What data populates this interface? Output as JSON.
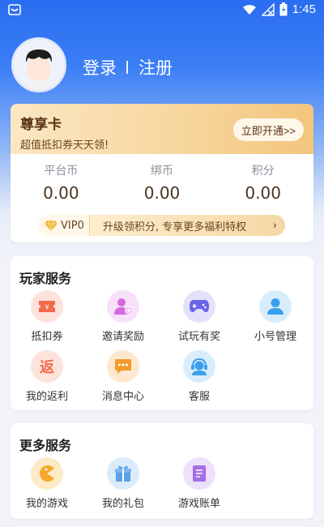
{
  "status_bar": {
    "time": "1:45"
  },
  "user": {
    "login_label": "登录",
    "register_label": "注册"
  },
  "vip_card": {
    "title": "尊享卡",
    "subtitle": "超值抵扣券天天领!",
    "open_button": "立即开通>>"
  },
  "stats": [
    {
      "label": "平台币",
      "value": "0.00"
    },
    {
      "label": "绑币",
      "value": "0.00"
    },
    {
      "label": "积分",
      "value": "0.00"
    }
  ],
  "vip_bar": {
    "level": "VIP0",
    "text": "升级领积分, 专享更多福利特权"
  },
  "player_services": {
    "title": "玩家服务",
    "items": [
      {
        "label": "抵扣券",
        "icon": "coupon-icon",
        "color": "#f26a4a",
        "bg": "#fde3dc"
      },
      {
        "label": "邀请奖励",
        "icon": "invite-user-icon",
        "color": "#d567e0",
        "bg": "#f8e0fb"
      },
      {
        "label": "试玩有奖",
        "icon": "gamepad-icon",
        "color": "#6a64e8",
        "bg": "#e4e2fb"
      },
      {
        "label": "小号管理",
        "icon": "account-icon",
        "color": "#3aa0ec",
        "bg": "#d8edfc"
      },
      {
        "label": "我的返利",
        "icon": "rebate-icon",
        "glyph": "返",
        "color": "#f26a4a",
        "bg": "#fde3dc"
      },
      {
        "label": "消息中心",
        "icon": "message-icon",
        "color": "#f59a2c",
        "bg": "#fde8cf"
      },
      {
        "label": "客服",
        "icon": "customer-service-icon",
        "color": "#3aa0ec",
        "bg": "#d8edfc"
      }
    ]
  },
  "more_services": {
    "title": "更多服务",
    "items": [
      {
        "label": "我的游戏",
        "icon": "game-icon",
        "color": "#f7a82c",
        "bg": "#fdebc8"
      },
      {
        "label": "我的礼包",
        "icon": "gift-icon",
        "color": "#5aa1e8",
        "bg": "#dcebfb"
      },
      {
        "label": "游戏账单",
        "icon": "bill-icon",
        "color": "#a56ee6",
        "bg": "#ece0fb"
      }
    ]
  }
}
